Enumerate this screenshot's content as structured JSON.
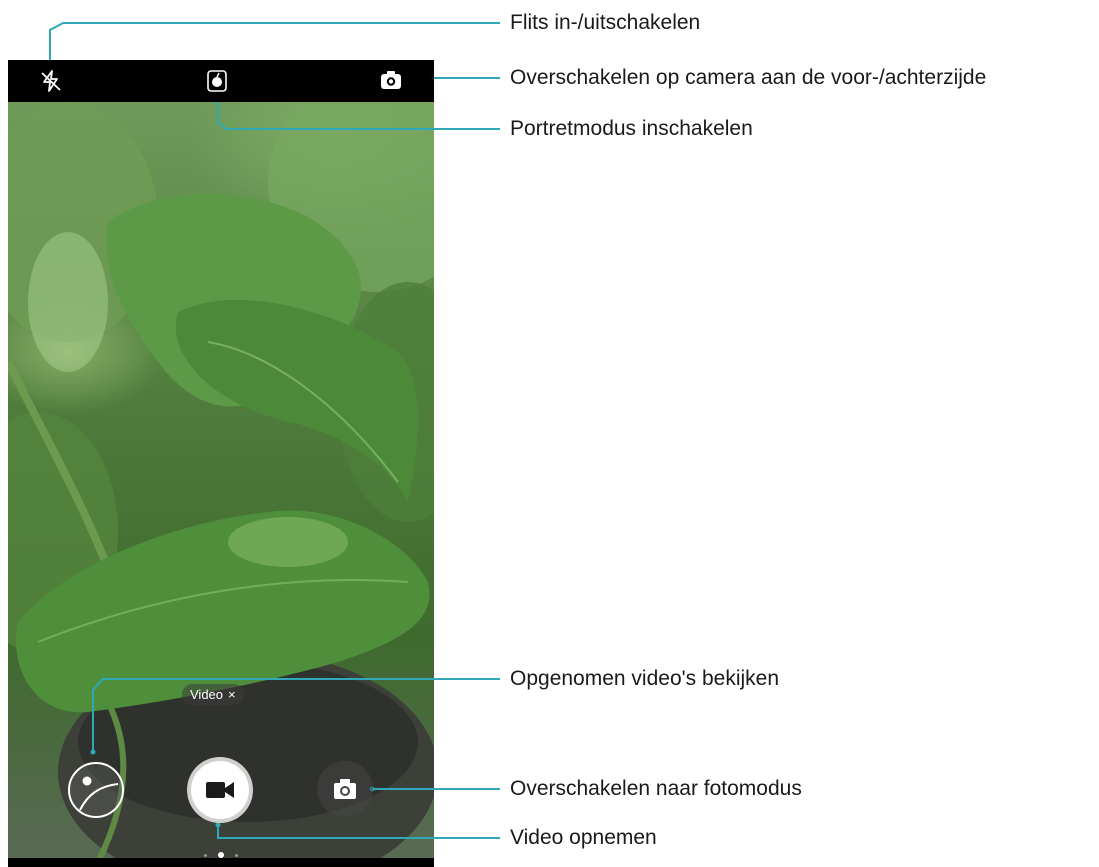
{
  "screen": {
    "mode_tag": {
      "label": "Video",
      "close_glyph": "×"
    },
    "icons": {
      "flash": "flash-off-icon",
      "portrait": "portrait-mode-icon",
      "switch_camera": "switch-camera-icon",
      "gallery": "gallery-thumbnail-icon",
      "record": "video-camera-icon",
      "photo_mode": "photo-camera-icon"
    },
    "page_dots": {
      "count": 3,
      "active_index": 1
    }
  },
  "callouts": {
    "flash": "Flits in-/uitschakelen",
    "switch_camera": "Overschakelen op camera aan de voor-/achterzijde",
    "portrait": "Portretmodus inschakelen",
    "gallery": "Opgenomen video's bekijken",
    "photo_mode": "Overschakelen naar fotomodus",
    "record": "Video opnemen"
  },
  "colors": {
    "callout_line": "#2fa8b8",
    "leaf_green": "#4f8a3c",
    "bar": "#000000"
  }
}
